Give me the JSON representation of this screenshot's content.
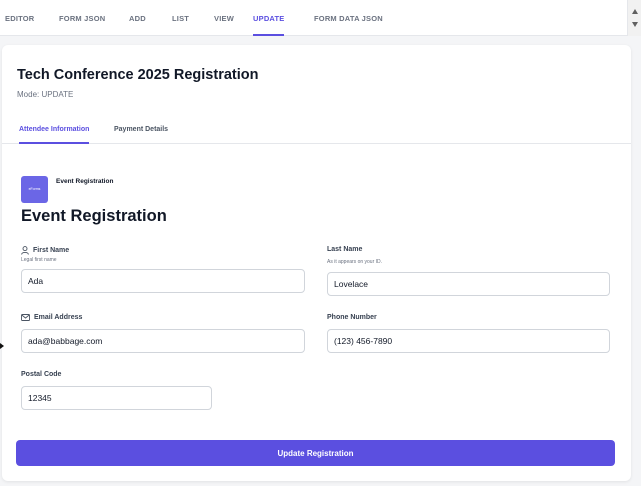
{
  "nav": {
    "tabs": [
      {
        "label": "EDITOR"
      },
      {
        "label": "FORM JSON"
      },
      {
        "label": "ADD"
      },
      {
        "label": "LIST"
      },
      {
        "label": "VIEW"
      },
      {
        "label": "UPDATE",
        "active": true
      },
      {
        "label": "FORM DATA JSON"
      }
    ]
  },
  "form": {
    "title": "Tech Conference 2025 Registration",
    "mode": "Mode: UPDATE",
    "tabs": [
      {
        "label": "Attendee Information",
        "active": true
      },
      {
        "label": "Payment Details"
      }
    ],
    "logo_text": "eForms",
    "logo_label": "Event Registration",
    "section_title": "Event Registration",
    "fields": {
      "first_name": {
        "label": "First Name",
        "help": "Legal first name",
        "value": "Ada",
        "icon": "user-icon"
      },
      "last_name": {
        "label": "Last Name",
        "help": "As it appears on your ID.",
        "value": "Lovelace"
      },
      "email": {
        "label": "Email Address",
        "value": "ada@babbage.com",
        "icon": "envelope-icon"
      },
      "phone": {
        "label": "Phone Number",
        "value": "(123) 456-7890"
      },
      "postal": {
        "label": "Postal Code",
        "value": "12345"
      }
    },
    "submit_label": "Update Registration"
  },
  "colors": {
    "accent": "#5b4fe0",
    "logo_bg": "#6b66e6",
    "background": "#f4f5f7"
  }
}
